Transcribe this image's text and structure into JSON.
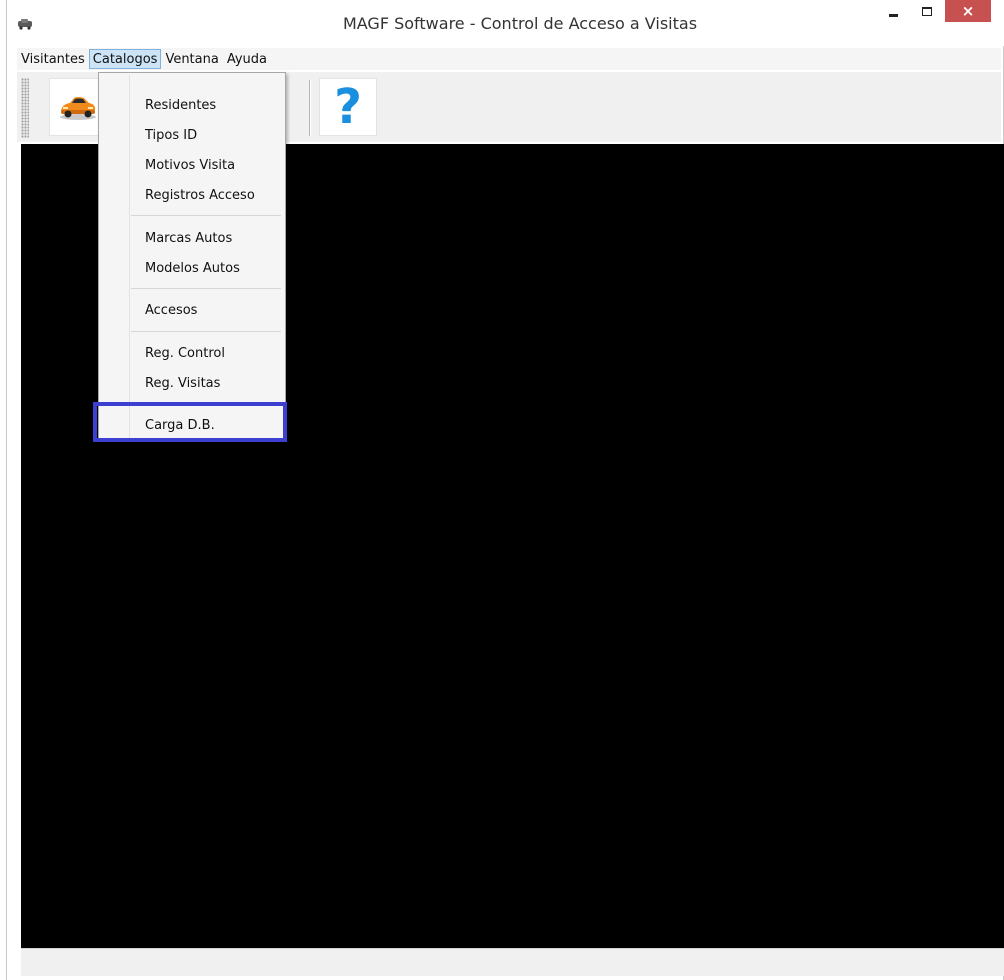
{
  "window": {
    "title": "MAGF Software - Control de Acceso a Visitas",
    "controls": {
      "minimize": "minimize",
      "maximize": "maximize",
      "close": "×"
    }
  },
  "menubar": {
    "items": [
      "Visitantes",
      "Catalogos",
      "Ventana",
      "Ayuda"
    ],
    "active": "Catalogos"
  },
  "toolbar": {
    "buttons": [
      {
        "icon": "car-icon"
      },
      {
        "icon": "help-icon",
        "glyph": "?"
      }
    ]
  },
  "dropdown": {
    "groups": [
      [
        "Residentes",
        "Tipos ID",
        "Motivos Visita",
        "Registros Acceso"
      ],
      [
        "Marcas Autos",
        "Modelos Autos"
      ],
      [
        "Accesos"
      ],
      [
        "Reg. Control",
        "Reg. Visitas"
      ],
      [
        "Carga D.B."
      ]
    ],
    "highlighted": "Carga D.B."
  },
  "colors": {
    "close_button": "#c75050",
    "menu_active": "#cde4f7",
    "highlight_box": "#3c3fd0",
    "content_background": "#000000",
    "help_icon": "#1a8fe0"
  }
}
